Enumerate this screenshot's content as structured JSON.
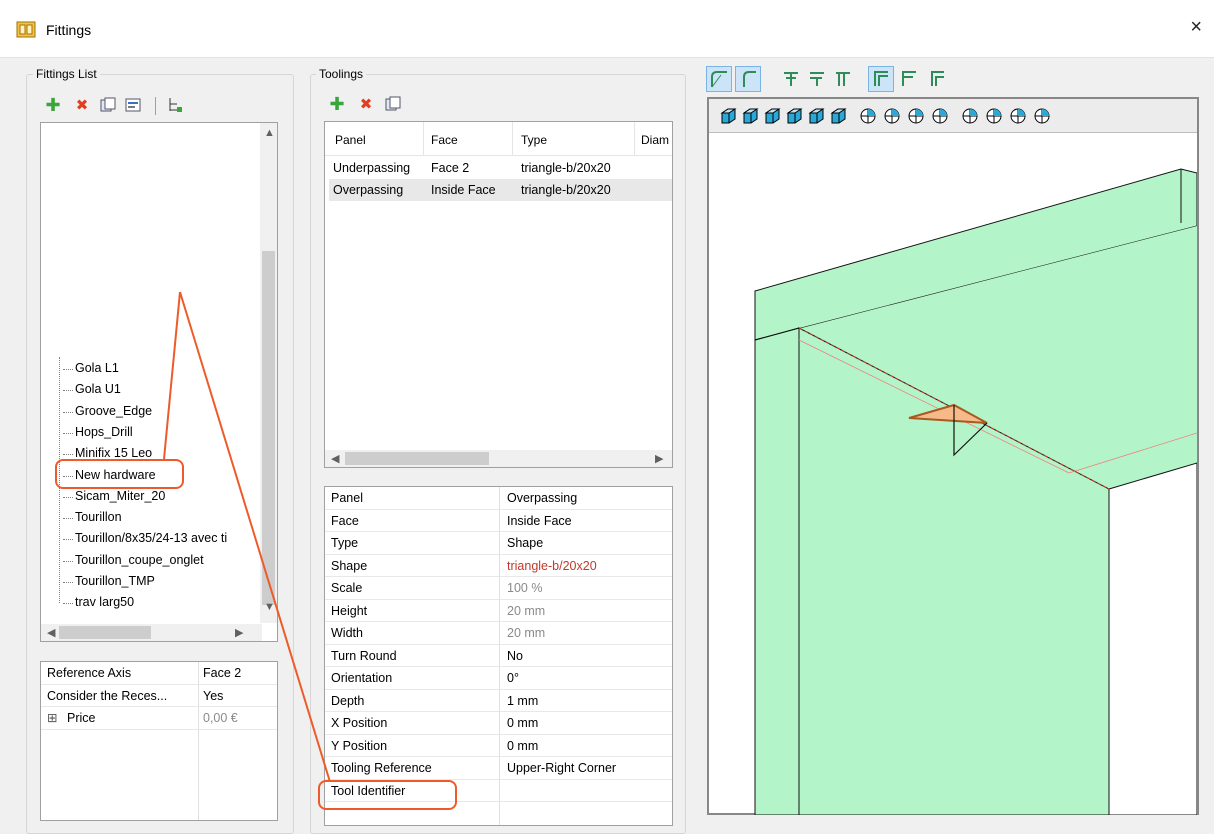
{
  "window": {
    "title": "Fittings",
    "close_label": "×"
  },
  "fittings_list": {
    "label": "Fittings List",
    "items": [
      "Gola L1",
      "Gola U1",
      "Groove_Edge",
      "Hops_Drill",
      "Minifix 15 Leo",
      "New hardware",
      "Sicam_Miter_20",
      "Tourillon",
      "Tourillon/8x35/24-13 avec ti",
      "Tourillon_coupe_onglet",
      "Tourillon_TMP",
      "trav larg50"
    ],
    "selected": "New hardware"
  },
  "fitting_props": {
    "rows": [
      {
        "name": "Reference Axis",
        "value": "Face 2"
      },
      {
        "name": "Consider the Reces...",
        "value": "Yes"
      },
      {
        "name": "Price",
        "value": "0,00 €",
        "expander": "⊞"
      }
    ]
  },
  "toolings": {
    "label": "Toolings",
    "columns": [
      "Panel",
      "Face",
      "Type",
      "Diam"
    ],
    "rows": [
      {
        "panel": "Underpassing",
        "face": "Face 2",
        "type": "triangle-b/20x20"
      },
      {
        "panel": "Overpassing",
        "face": "Inside Face",
        "type": "triangle-b/20x20"
      }
    ]
  },
  "tooling_props": {
    "rows": [
      {
        "name": "Panel",
        "value": "Overpassing"
      },
      {
        "name": "Face",
        "value": "Inside Face"
      },
      {
        "name": "Type",
        "value": "Shape"
      },
      {
        "name": "Shape",
        "value": "triangle-b/20x20"
      },
      {
        "name": "Scale",
        "value": "100 %"
      },
      {
        "name": "Height",
        "value": "20 mm"
      },
      {
        "name": "Width",
        "value": "20 mm"
      },
      {
        "name": "Turn Round",
        "value": "No"
      },
      {
        "name": "Orientation",
        "value": "0°"
      },
      {
        "name": "Depth",
        "value": "1 mm"
      },
      {
        "name": "X Position",
        "value": "0 mm"
      },
      {
        "name": "Y Position",
        "value": "0 mm"
      },
      {
        "name": "Tooling Reference",
        "value": "Upper-Right Corner"
      },
      {
        "name": "Tool Identifier",
        "value": ""
      }
    ]
  },
  "colors": {
    "panel_fill": "#b3f5c9",
    "annotation": "#ee5b2a",
    "shape_value": "#c0392b",
    "greyed_value": "#8a8a8a",
    "selection": "#cce4f7"
  }
}
